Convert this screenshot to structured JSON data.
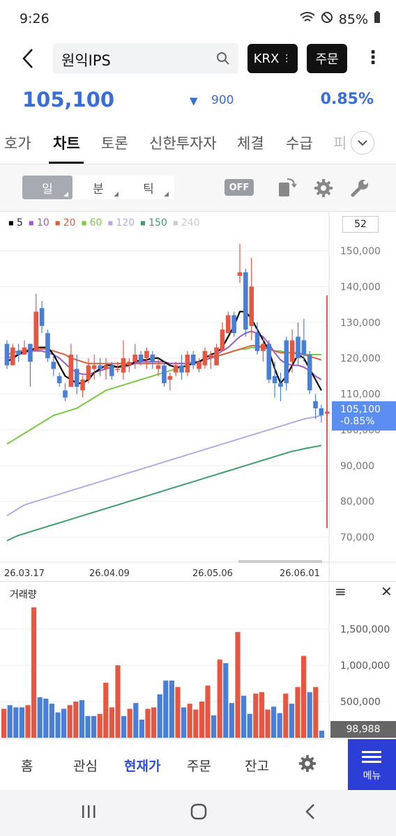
{
  "status": {
    "time": "9:26",
    "battery": "85%"
  },
  "header": {
    "search_value": "원익IPS",
    "krx_label": "KRX",
    "order_label": "주문"
  },
  "price": {
    "current": "105,100",
    "change": "900",
    "change_pct": "0.85%"
  },
  "tabs": [
    {
      "label": "호가"
    },
    {
      "label": "차트"
    },
    {
      "label": "토론"
    },
    {
      "label": "신한투자자"
    },
    {
      "label": "체결"
    },
    {
      "label": "수급"
    },
    {
      "label": "피"
    }
  ],
  "toolbar": {
    "day": "일",
    "minute": "분",
    "tick": "틱",
    "off": "OFF"
  },
  "chart": {
    "count_box": "52",
    "legend": [
      {
        "label": "5",
        "color": "#000000"
      },
      {
        "label": "10",
        "color": "#9b59d0"
      },
      {
        "label": "20",
        "color": "#d8603a"
      },
      {
        "label": "60",
        "color": "#7ac943"
      },
      {
        "label": "120",
        "color": "#b9a8e6"
      },
      {
        "label": "150",
        "color": "#3f9d6b"
      },
      {
        "label": "240",
        "color": "#cccccc"
      }
    ],
    "y_ticks": [
      "150,000",
      "140,000",
      "130,000",
      "120,000",
      "110,000",
      "100,000",
      "90,000",
      "80,000",
      "70,000"
    ],
    "x_ticks": [
      "26.03.17",
      "26.04.09",
      "26.05.06",
      "26.06.01"
    ],
    "price_tag_value": "105,100",
    "price_tag_pct": "-0.85%"
  },
  "volume": {
    "title": "거래량",
    "y_ticks": [
      "1,500,000",
      "1,000,000",
      "500,000"
    ],
    "last_value": "98,988"
  },
  "bottom_nav": {
    "home": "홈",
    "watch": "관심",
    "current": "현재가",
    "order": "주문",
    "balance": "잔고",
    "menu": "메뉴"
  },
  "chart_data": {
    "type": "candlestick",
    "ylim": [
      65000,
      155000
    ],
    "candles": [
      {
        "o": 124000,
        "h": 125000,
        "l": 117000,
        "c": 118000
      },
      {
        "o": 118000,
        "h": 124000,
        "l": 118000,
        "c": 123000
      },
      {
        "o": 122000,
        "h": 124000,
        "l": 119000,
        "c": 121000
      },
      {
        "o": 121000,
        "h": 125000,
        "l": 121000,
        "c": 123000
      },
      {
        "o": 124000,
        "h": 124000,
        "l": 112000,
        "c": 119000
      },
      {
        "o": 122000,
        "h": 138000,
        "l": 122000,
        "c": 133000
      },
      {
        "o": 134000,
        "h": 136000,
        "l": 127000,
        "c": 129000
      },
      {
        "o": 127000,
        "h": 128000,
        "l": 119000,
        "c": 120000
      },
      {
        "o": 119000,
        "h": 121000,
        "l": 115000,
        "c": 117000
      },
      {
        "o": 115000,
        "h": 116000,
        "l": 112000,
        "c": 113000
      },
      {
        "o": 111000,
        "h": 113000,
        "l": 108000,
        "c": 109000
      },
      {
        "o": 112000,
        "h": 124000,
        "l": 112000,
        "c": 121000
      },
      {
        "o": 117000,
        "h": 121000,
        "l": 110000,
        "c": 112000
      },
      {
        "o": 111000,
        "h": 115000,
        "l": 109000,
        "c": 114000
      },
      {
        "o": 114000,
        "h": 120000,
        "l": 113000,
        "c": 118000
      },
      {
        "o": 117000,
        "h": 121000,
        "l": 114000,
        "c": 118000
      },
      {
        "o": 118000,
        "h": 120000,
        "l": 115000,
        "c": 117000
      },
      {
        "o": 117000,
        "h": 120000,
        "l": 114000,
        "c": 118000
      },
      {
        "o": 118000,
        "h": 119000,
        "l": 114000,
        "c": 115000
      },
      {
        "o": 117000,
        "h": 119000,
        "l": 116000,
        "c": 117000
      },
      {
        "o": 116000,
        "h": 125000,
        "l": 114000,
        "c": 120000
      },
      {
        "o": 118000,
        "h": 120000,
        "l": 116000,
        "c": 119000
      },
      {
        "o": 119000,
        "h": 124000,
        "l": 117000,
        "c": 121000
      },
      {
        "o": 121000,
        "h": 122000,
        "l": 118000,
        "c": 119000
      },
      {
        "o": 120000,
        "h": 123000,
        "l": 117000,
        "c": 122000
      },
      {
        "o": 121000,
        "h": 122000,
        "l": 117000,
        "c": 119000
      },
      {
        "o": 117000,
        "h": 120000,
        "l": 115000,
        "c": 118000
      },
      {
        "o": 118000,
        "h": 119000,
        "l": 112000,
        "c": 113000
      },
      {
        "o": 114000,
        "h": 116000,
        "l": 111000,
        "c": 115000
      },
      {
        "o": 116000,
        "h": 119000,
        "l": 115000,
        "c": 118000
      },
      {
        "o": 118000,
        "h": 121000,
        "l": 114000,
        "c": 116000
      },
      {
        "o": 116000,
        "h": 122000,
        "l": 115000,
        "c": 121000
      },
      {
        "o": 121000,
        "h": 122000,
        "l": 117000,
        "c": 118000
      },
      {
        "o": 117000,
        "h": 120000,
        "l": 116000,
        "c": 119000
      },
      {
        "o": 118000,
        "h": 123000,
        "l": 117000,
        "c": 122000
      },
      {
        "o": 120000,
        "h": 122000,
        "l": 117000,
        "c": 121000
      },
      {
        "o": 118000,
        "h": 124000,
        "l": 118000,
        "c": 123000
      },
      {
        "o": 122000,
        "h": 130000,
        "l": 122000,
        "c": 128000
      },
      {
        "o": 127000,
        "h": 133000,
        "l": 127000,
        "c": 132000
      },
      {
        "o": 132000,
        "h": 133000,
        "l": 126000,
        "c": 127000
      },
      {
        "o": 143000,
        "h": 152000,
        "l": 141000,
        "c": 144000
      },
      {
        "o": 144000,
        "h": 145000,
        "l": 126000,
        "c": 128000
      },
      {
        "o": 129000,
        "h": 148000,
        "l": 125000,
        "c": 140000
      },
      {
        "o": 127000,
        "h": 130000,
        "l": 121000,
        "c": 122000
      },
      {
        "o": 122000,
        "h": 126000,
        "l": 119000,
        "c": 124000
      },
      {
        "o": 124000,
        "h": 125000,
        "l": 113000,
        "c": 114000
      },
      {
        "o": 115000,
        "h": 119000,
        "l": 109000,
        "c": 113000
      },
      {
        "o": 113000,
        "h": 116000,
        "l": 108000,
        "c": 112000
      },
      {
        "o": 125000,
        "h": 126000,
        "l": 111000,
        "c": 113000
      },
      {
        "o": 119000,
        "h": 128000,
        "l": 116000,
        "c": 125000
      },
      {
        "o": 126000,
        "h": 130000,
        "l": 118000,
        "c": 120000
      },
      {
        "o": 125000,
        "h": 131000,
        "l": 119000,
        "c": 121000
      },
      {
        "o": 121000,
        "h": 122000,
        "l": 110000,
        "c": 111000
      },
      {
        "o": 108000,
        "h": 110000,
        "l": 103000,
        "c": 106000
      },
      {
        "o": 106000,
        "h": 107000,
        "l": 102000,
        "c": 104000
      },
      {
        "o": 104500,
        "h": 106000,
        "l": 102000,
        "c": 105100
      }
    ],
    "ma": {
      "5": [
        119000,
        120000,
        121000,
        122000,
        122000,
        123000,
        123000,
        123000,
        121000,
        118000,
        115000,
        114000,
        113000,
        113000,
        114000,
        116000,
        117000,
        118000,
        118000,
        117500,
        118000,
        118000,
        119000,
        119500,
        119500,
        120000,
        120000,
        119000,
        118000,
        117500,
        117500,
        118000,
        118500,
        119000,
        120000,
        121000,
        121500,
        123000,
        126000,
        129000,
        133000,
        133000,
        131000,
        128000,
        125000,
        122000,
        117000,
        113000,
        115000,
        118000,
        121000,
        120000,
        117000,
        114000,
        111000
      ],
      "10": [
        120000,
        120500,
        121000,
        121500,
        122000,
        122000,
        122000,
        121500,
        121000,
        120000,
        118500,
        117000,
        116000,
        115500,
        115500,
        116000,
        116500,
        117000,
        117500,
        117500,
        117500,
        118000,
        118500,
        119000,
        119000,
        119000,
        119000,
        119000,
        118500,
        118500,
        118500,
        118500,
        119000,
        119000,
        119500,
        120000,
        121000,
        122000,
        123000,
        124500,
        126000,
        127000,
        127500,
        127000,
        126000,
        124000,
        121500,
        119500,
        118500,
        118000,
        118000,
        117500,
        116500,
        115000,
        114000
      ],
      "20": [
        121000,
        121500,
        122000,
        122000,
        122500,
        122500,
        122500,
        122500,
        122000,
        121500,
        121000,
        120000,
        119500,
        119000,
        118500,
        118500,
        118500,
        118500,
        118500,
        118500,
        118500,
        118500,
        118500,
        118500,
        118500,
        118500,
        118500,
        118500,
        118500,
        118500,
        118500,
        118500,
        119000,
        119000,
        119500,
        120000,
        120500,
        121000,
        121500,
        122000,
        122500,
        123000,
        123500,
        123500,
        123000,
        122500,
        122000,
        121500,
        121500,
        121500,
        121500,
        121000,
        120500,
        120000,
        119500
      ],
      "60": [
        96000,
        97000,
        98000,
        99000,
        100000,
        101000,
        102000,
        103000,
        104000,
        104500,
        105000,
        105500,
        106000,
        107000,
        108000,
        109000,
        110000,
        111000,
        111500,
        112000,
        112500,
        113000,
        113500,
        114000,
        114500,
        115000,
        115500,
        116000,
        116500,
        117000,
        117500,
        118000,
        118500,
        119000,
        119500,
        120000,
        120500,
        121000,
        121500,
        122000,
        122500,
        122500,
        123000,
        123000,
        123000,
        122500,
        122000,
        122000,
        121500,
        121500,
        121000,
        121000,
        121000,
        121000,
        121000
      ],
      "120": [
        76000,
        77000,
        78000,
        79000,
        79500,
        80000,
        80500,
        81000,
        81500,
        82000,
        82500,
        83000,
        83500,
        84000,
        84500,
        85000,
        85500,
        86000,
        86500,
        87000,
        87500,
        88000,
        88500,
        89000,
        89500,
        90000,
        90500,
        91000,
        91500,
        92000,
        92500,
        93000,
        93500,
        94000,
        94500,
        95000,
        95500,
        96000,
        96500,
        97000,
        97500,
        98000,
        98500,
        99000,
        99500,
        100000,
        100500,
        101000,
        101500,
        102000,
        102500,
        103000,
        103300,
        103600,
        104000
      ],
      "150": [
        69000,
        69800,
        70500,
        71000,
        71500,
        72000,
        72500,
        73000,
        73500,
        74000,
        74500,
        75000,
        75500,
        76000,
        76500,
        77000,
        77500,
        78000,
        78500,
        79000,
        79500,
        80000,
        80500,
        81000,
        81500,
        82000,
        82500,
        83000,
        83500,
        84000,
        84500,
        85000,
        85500,
        86000,
        86500,
        87000,
        87500,
        88000,
        88500,
        89000,
        89500,
        90000,
        90500,
        91000,
        91500,
        92000,
        92500,
        93000,
        93500,
        94000,
        94300,
        94700,
        95000,
        95300,
        95600
      ]
    },
    "volumes": [
      [
        400000,
        "u"
      ],
      [
        450000,
        "d"
      ],
      [
        420000,
        "d"
      ],
      [
        420000,
        "d"
      ],
      [
        450000,
        "u"
      ],
      [
        1800000,
        "u"
      ],
      [
        560000,
        "d"
      ],
      [
        540000,
        "d"
      ],
      [
        470000,
        "d"
      ],
      [
        350000,
        "d"
      ],
      [
        400000,
        "d"
      ],
      [
        450000,
        "u"
      ],
      [
        500000,
        "u"
      ],
      [
        520000,
        "d"
      ],
      [
        300000,
        "d"
      ],
      [
        300000,
        "d"
      ],
      [
        330000,
        "u"
      ],
      [
        760000,
        "u"
      ],
      [
        420000,
        "u"
      ],
      [
        1000000,
        "u"
      ],
      [
        300000,
        "d"
      ],
      [
        400000,
        "u"
      ],
      [
        480000,
        "d"
      ],
      [
        250000,
        "d"
      ],
      [
        400000,
        "u"
      ],
      [
        420000,
        "u"
      ],
      [
        600000,
        "d"
      ],
      [
        790000,
        "d"
      ],
      [
        790000,
        "d"
      ],
      [
        700000,
        "u"
      ],
      [
        420000,
        "d"
      ],
      [
        470000,
        "u"
      ],
      [
        390000,
        "u"
      ],
      [
        500000,
        "u"
      ],
      [
        720000,
        "u"
      ],
      [
        310000,
        "d"
      ],
      [
        1080000,
        "u"
      ],
      [
        1030000,
        "d"
      ],
      [
        480000,
        "d"
      ],
      [
        1460000,
        "u"
      ],
      [
        580000,
        "d"
      ],
      [
        330000,
        "d"
      ],
      [
        610000,
        "u"
      ],
      [
        630000,
        "u"
      ],
      [
        390000,
        "u"
      ],
      [
        430000,
        "d"
      ],
      [
        340000,
        "d"
      ],
      [
        610000,
        "u"
      ],
      [
        470000,
        "d"
      ],
      [
        700000,
        "u"
      ],
      [
        1130000,
        "u"
      ],
      [
        630000,
        "d"
      ],
      [
        700000,
        "u"
      ],
      [
        98988,
        "d"
      ]
    ]
  }
}
